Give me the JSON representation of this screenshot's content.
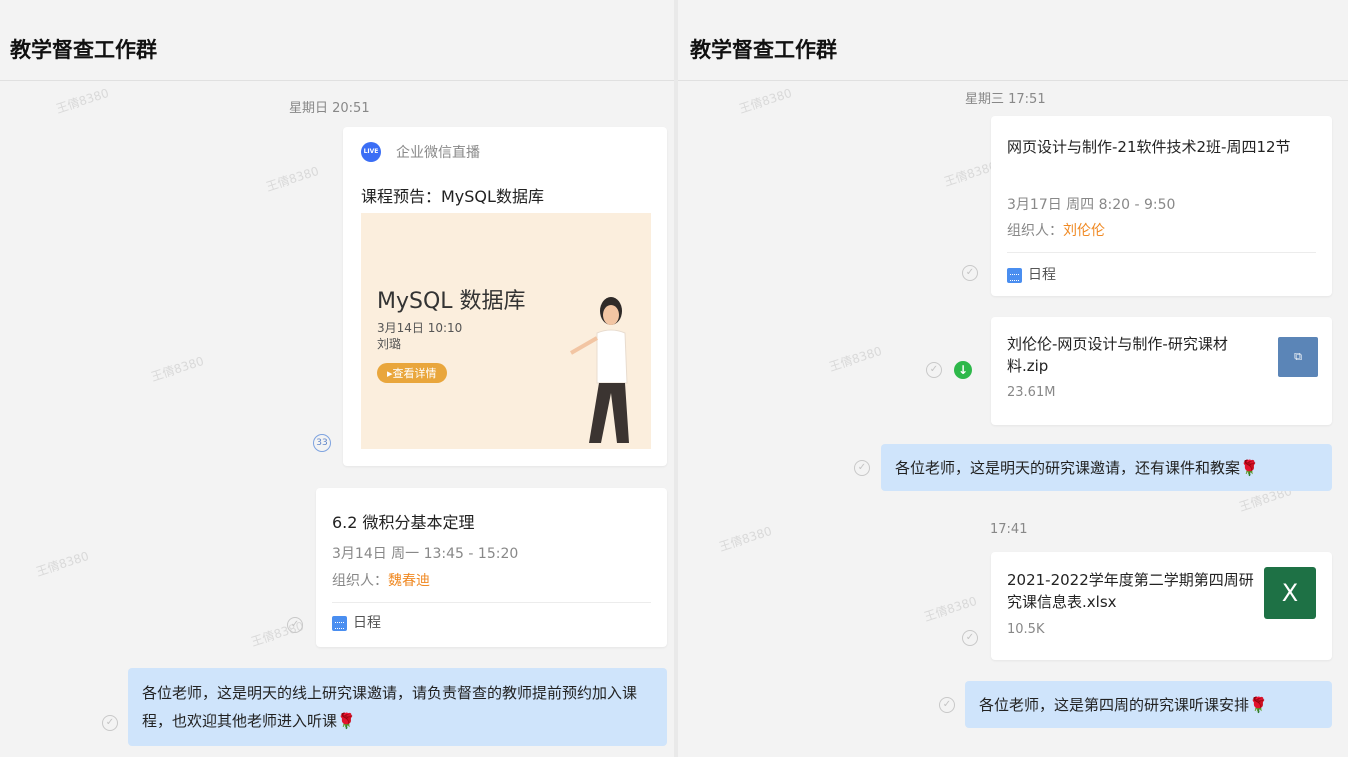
{
  "left": {
    "title": "教学督查工作群",
    "watermark": "王倩8380",
    "timestamp": "星期日 20:51",
    "live_card": {
      "source": "企业微信直播",
      "live_badge": "LIVE",
      "heading": "课程预告：MySQL数据库",
      "banner_title": "MySQL 数据库",
      "banner_date": "3月14日 10:10",
      "banner_name": "刘璐",
      "banner_button": "▸查看详情",
      "read_count": "33"
    },
    "schedule_card": {
      "title": "6.2 微积分基本定理",
      "time": "3月14日 周一 13:45 - 15:20",
      "organizer_label": "组织人：",
      "organizer": "魏春迪",
      "footer": "日程"
    },
    "message": {
      "text": "各位老师，这是明天的线上研究课邀请，请负责督查的教师提前预约加入课程，也欢迎其他老师进入听课",
      "emoji": "🌹"
    }
  },
  "right": {
    "title": "教学督查工作群",
    "watermark": "王倩8380",
    "timestamp1": "星期三 17:51",
    "schedule_card": {
      "title": "网页设计与制作-21软件技术2班-周四12节",
      "time": "3月17日 周四 8:20 - 9:50",
      "organizer_label": "组织人：",
      "organizer": "刘伦伦",
      "footer": "日程"
    },
    "zip_file": {
      "name": "刘伦伦-网页设计与制作-研究课材料.zip",
      "size": "23.61M",
      "icon": "zip-file-icon"
    },
    "message1": {
      "text": "各位老师，这是明天的研究课邀请，还有课件和教案",
      "emoji": "🌹"
    },
    "timestamp2": "17:41",
    "xlsx_file": {
      "name": "2021-2022学年度第二学期第四周研究课信息表.xlsx",
      "size": "10.5K",
      "icon_letter": "X"
    },
    "message2": {
      "text": "各位老师，这是第四周的研究课听课安排",
      "emoji": "🌹"
    }
  }
}
